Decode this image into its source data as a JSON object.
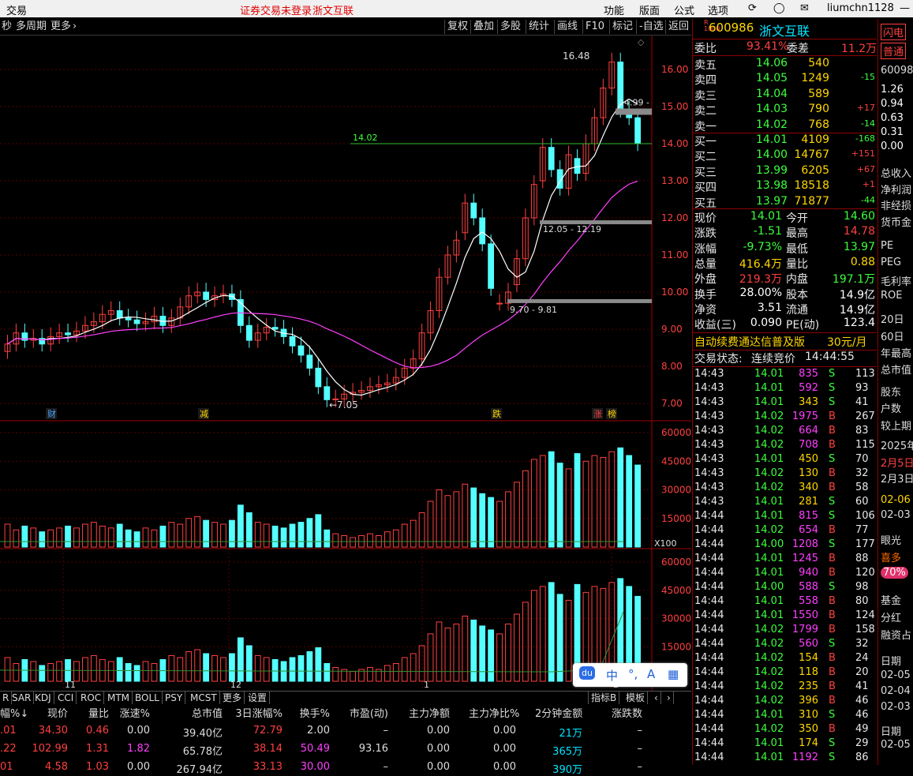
{
  "menubar": {
    "app": "交易",
    "notice": "证券交易未登录",
    "stock_name": "浙文互联",
    "menus": [
      "功能",
      "版面",
      "公式",
      "选项"
    ],
    "user": "liumchn1128"
  },
  "toolbar": {
    "left_items": [
      "秒",
      "多周期",
      "更多"
    ],
    "right_items": [
      "复权",
      "叠加",
      "多股",
      "统计",
      "画线",
      "F10",
      "标记",
      "-自选",
      "返回"
    ]
  },
  "quote": {
    "code": "600986",
    "name": "浙文互联",
    "weibi_label": "委比",
    "weibi": "93.41%",
    "weicha_label": "委差",
    "weicha": "11.2万",
    "asks": [
      {
        "label": "卖五",
        "price": "14.06",
        "vol": "540",
        "chg": ""
      },
      {
        "label": "卖四",
        "price": "14.05",
        "vol": "1249",
        "chg": "-15"
      },
      {
        "label": "卖三",
        "price": "14.04",
        "vol": "589",
        "chg": ""
      },
      {
        "label": "卖二",
        "price": "14.03",
        "vol": "790",
        "chg": "+17"
      },
      {
        "label": "卖一",
        "price": "14.02",
        "vol": "768",
        "chg": "-14"
      }
    ],
    "bids": [
      {
        "label": "买一",
        "price": "14.01",
        "vol": "4109",
        "chg": "-168"
      },
      {
        "label": "买二",
        "price": "14.00",
        "vol": "14767",
        "chg": "+151"
      },
      {
        "label": "买三",
        "price": "13.99",
        "vol": "6205",
        "chg": "+67"
      },
      {
        "label": "买四",
        "price": "13.98",
        "vol": "18518",
        "chg": "+1"
      },
      {
        "label": "买五",
        "price": "13.97",
        "vol": "71877",
        "chg": "-44"
      }
    ],
    "stats": [
      {
        "l1": "现价",
        "v1": "14.01",
        "l2": "今开",
        "v2": "14.60"
      },
      {
        "l1": "涨跌",
        "v1": "-1.51",
        "l2": "最高",
        "v2": "14.78"
      },
      {
        "l1": "涨幅",
        "v1": "-9.73%",
        "l2": "最低",
        "v2": "13.97"
      },
      {
        "l1": "总量",
        "v1": "416.4万",
        "l2": "量比",
        "v2": "0.88"
      },
      {
        "l1": "外盘",
        "v1": "219.3万",
        "l2": "内盘",
        "v2": "197.1万"
      },
      {
        "l1": "换手",
        "v1": "28.00%",
        "l2": "股本",
        "v2": "14.9亿"
      },
      {
        "l1": "净资",
        "v1": "3.51",
        "l2": "流通",
        "v2": "14.9亿"
      },
      {
        "l1": "收益(三)",
        "v1": "0.090",
        "l2": "PE(动)",
        "v2": "123.4"
      }
    ],
    "ad_text": "自动续费通达信普及版",
    "ad_price": "30元/月",
    "status_label": "交易状态:",
    "status": "连续竞价",
    "status_time": "14:44:55",
    "ticks": [
      [
        "14:43",
        "14.01",
        "835",
        "S",
        "113"
      ],
      [
        "14:43",
        "14.01",
        "592",
        "S",
        "93"
      ],
      [
        "14:43",
        "14.01",
        "343",
        "S",
        "41"
      ],
      [
        "14:43",
        "14.02",
        "1975",
        "B",
        "267"
      ],
      [
        "14:43",
        "14.02",
        "664",
        "B",
        "83"
      ],
      [
        "14:43",
        "14.02",
        "708",
        "B",
        "115"
      ],
      [
        "14:43",
        "14.01",
        "450",
        "S",
        "70"
      ],
      [
        "14:43",
        "14.02",
        "130",
        "B",
        "32"
      ],
      [
        "14:43",
        "14.02",
        "340",
        "B",
        "58"
      ],
      [
        "14:43",
        "14.01",
        "281",
        "S",
        "60"
      ],
      [
        "14:44",
        "14.01",
        "815",
        "S",
        "106"
      ],
      [
        "14:44",
        "14.02",
        "654",
        "B",
        "77"
      ],
      [
        "14:44",
        "14.00",
        "1208",
        "S",
        "177"
      ],
      [
        "14:44",
        "14.01",
        "1245",
        "B",
        "88"
      ],
      [
        "14:44",
        "14.01",
        "940",
        "B",
        "120"
      ],
      [
        "14:44",
        "14.00",
        "588",
        "S",
        "98"
      ],
      [
        "14:44",
        "14.01",
        "558",
        "B",
        "80"
      ],
      [
        "14:44",
        "14.01",
        "1550",
        "B",
        "124"
      ],
      [
        "14:44",
        "14.02",
        "1799",
        "B",
        "158"
      ],
      [
        "14:44",
        "14.02",
        "560",
        "S",
        "32"
      ],
      [
        "14:44",
        "14.02",
        "154",
        "B",
        "24"
      ],
      [
        "14:44",
        "14.02",
        "118",
        "B",
        "20"
      ],
      [
        "14:44",
        "14.02",
        "235",
        "B",
        "41"
      ],
      [
        "14:44",
        "14.02",
        "396",
        "B",
        "46"
      ],
      [
        "14:44",
        "14.01",
        "310",
        "S",
        "46"
      ],
      [
        "14:44",
        "14.02",
        "350",
        "B",
        "49"
      ],
      [
        "14:44",
        "14.01",
        "174",
        "S",
        "29"
      ],
      [
        "14:44",
        "14.01",
        "1192",
        "S",
        "86"
      ]
    ]
  },
  "farright": {
    "items": [
      "闪电",
      "普通",
      "60098",
      "1.26",
      "0.94",
      "0.63",
      "0.31",
      "0.00",
      "总收入",
      "净利润",
      "非经损",
      "货币金",
      "PE",
      "PEG",
      "毛利率",
      "ROE",
      "20日",
      "60日",
      "年最高",
      "总市值",
      "股东",
      "户数",
      "较上期",
      "2025年",
      "2月5日",
      "2月3日",
      "02-06",
      "02-03",
      "眼光",
      "喜多",
      "70%",
      "基金",
      "分红",
      "融资占",
      "日期",
      "02-05",
      "02-04",
      "02-03",
      "日期",
      "02-05"
    ]
  },
  "chart": {
    "price_axis": [
      "16.00",
      "15.00",
      "14.00",
      "13.00",
      "12.00",
      "11.00",
      "10.00",
      "9.00",
      "8.00",
      "7.00"
    ],
    "vol_axis": [
      "60000",
      "45000",
      "30000",
      "15000"
    ],
    "vol_unit": "X100",
    "vol2_axis": [
      "60000",
      "45000",
      "30000",
      "15000"
    ],
    "annotations": {
      "high": "16.48",
      "low": "7.05",
      "level_1499": "14.99 -",
      "level_1402": "14.02",
      "range_1": "12.05 - 12.19",
      "range_2": "9.70 - 9.81"
    },
    "event_markers": [
      "财",
      "减",
      "跌",
      "涨",
      "榜"
    ],
    "month_marks": [
      "11",
      "12",
      "1",
      "2"
    ]
  },
  "indicator_tabs": [
    "R",
    "SAR",
    "KDJ",
    "CCI",
    "ROC",
    "MTM",
    "BOLL",
    "PSY",
    "MCST",
    "更多",
    "设置"
  ],
  "indicator_right": [
    "指标B",
    "模板"
  ],
  "bottom_table": {
    "headers": [
      "幅%↓",
      "现价",
      "量比",
      "涨速%",
      "总市值",
      "3日涨幅%",
      "换手%",
      "市盈(动)",
      "主力净额",
      "主力净比%",
      "2分钟金额",
      "涨跌数"
    ],
    "rows": [
      [
        ".01",
        "34.30",
        "0.46",
        "0.00",
        "39.40亿",
        "72.79",
        "2.00",
        "–",
        "0.00",
        "0.00",
        "21万",
        "–"
      ],
      [
        ".22",
        "102.99",
        "1.31",
        "1.82",
        "65.78亿",
        "38.14",
        "50.49",
        "93.16",
        "0.00",
        "0.00",
        "365万",
        "–"
      ],
      [
        "01",
        "4.58",
        "1.03",
        "0.00",
        "267.94亿",
        "33.13",
        "30.00",
        "–",
        "0.00",
        "0.00",
        "390万",
        "–"
      ]
    ]
  },
  "ime": {
    "chars": [
      "中",
      "°,",
      "A",
      "▦"
    ]
  },
  "colors": {
    "up": "#ff4040",
    "down": "#54ffff",
    "ma5": "#ffffff",
    "ma20": "#ff40ff",
    "grid": "#8b0000",
    "axis": "#ff4040"
  }
}
